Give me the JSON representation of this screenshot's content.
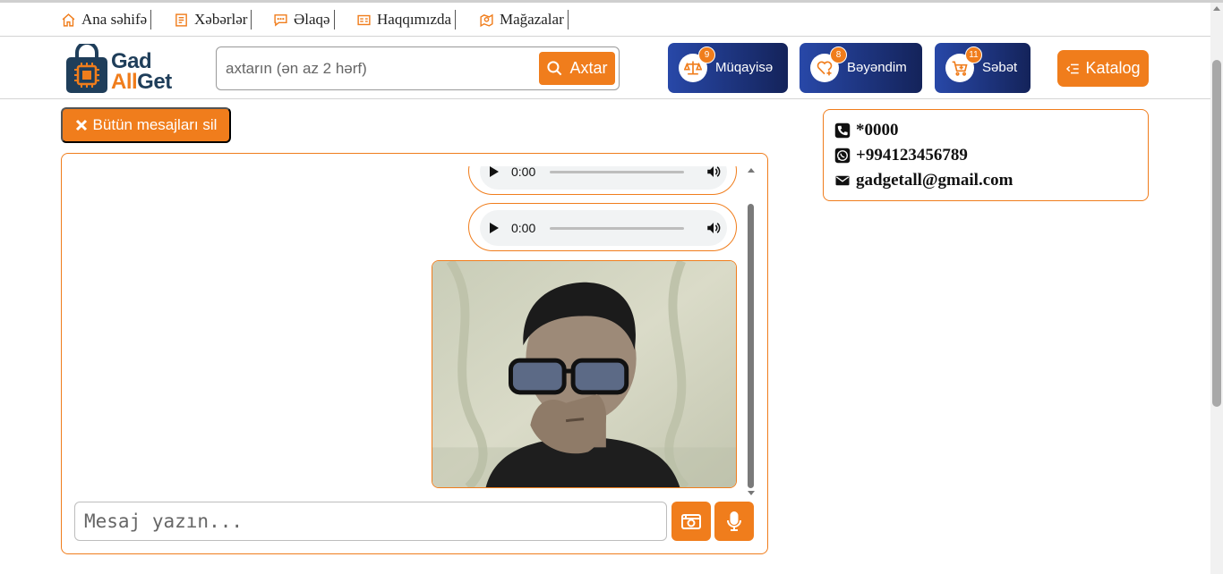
{
  "nav": {
    "items": [
      {
        "label": "Ana səhifə",
        "icon": "home-icon"
      },
      {
        "label": "Xəbərlər",
        "icon": "news-icon"
      },
      {
        "label": "Əlaqə",
        "icon": "chat-icon"
      },
      {
        "label": "Haqqımızda",
        "icon": "id-card-icon"
      },
      {
        "label": "Mağazalar",
        "icon": "store-map-icon"
      }
    ]
  },
  "logo": {
    "line1": "Gad",
    "line2a": "All",
    "line2b": "Get"
  },
  "search": {
    "placeholder": "axtarın (ən az 2 hərf)",
    "button_label": "Axtar"
  },
  "header_buttons": [
    {
      "label": "Müqayisə",
      "badge": "9",
      "icon": "scale-icon"
    },
    {
      "label": "Bəyəndim",
      "badge": "8",
      "icon": "heart-plus-icon"
    },
    {
      "label": "Səbət",
      "badge": "11",
      "icon": "cart-icon"
    }
  ],
  "katalog": {
    "label": "Katalog"
  },
  "chat": {
    "delete_all_label": "Bütün mesajları sil",
    "audio_messages": [
      {
        "time": "0:00"
      },
      {
        "time": "0:00"
      }
    ],
    "input_placeholder": "Mesaj yazın..."
  },
  "contact": {
    "phone": "*0000",
    "whatsapp": "+994123456789",
    "email": "gadgetall@gmail.com"
  },
  "colors": {
    "accent": "#f07d1c",
    "navy": "#1f3e5a",
    "button_gradient_start": "#2848a8",
    "button_gradient_end": "#14235a"
  }
}
